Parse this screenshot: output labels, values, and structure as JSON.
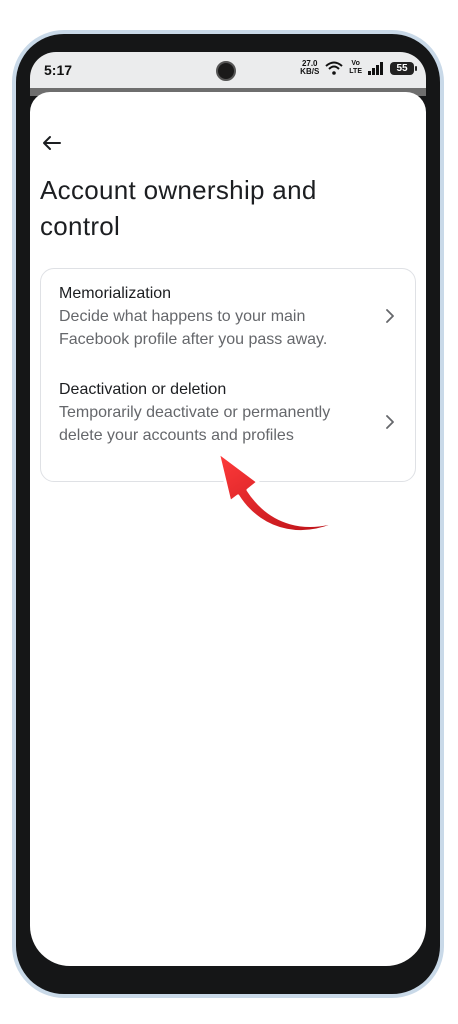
{
  "status_bar": {
    "time": "5:17",
    "net_speed_value": "27.0",
    "net_speed_unit": "KB/S",
    "volte_top": "Vo",
    "volte_bottom": "LTE",
    "battery": "55"
  },
  "header": {
    "back_icon": "arrow-left-icon",
    "title": "Account ownership and control"
  },
  "options": [
    {
      "title": "Memorialization",
      "description": "Decide what happens to your main Facebook profile after you pass away."
    },
    {
      "title": "Deactivation or deletion",
      "description": "Temporarily deactivate or permanently delete your accounts and profiles"
    }
  ],
  "colors": {
    "title_text": "#1c1e21",
    "secondary_text": "#65676b",
    "card_border": "#dfe1e5",
    "annotation_arrow": "#e8232a"
  }
}
